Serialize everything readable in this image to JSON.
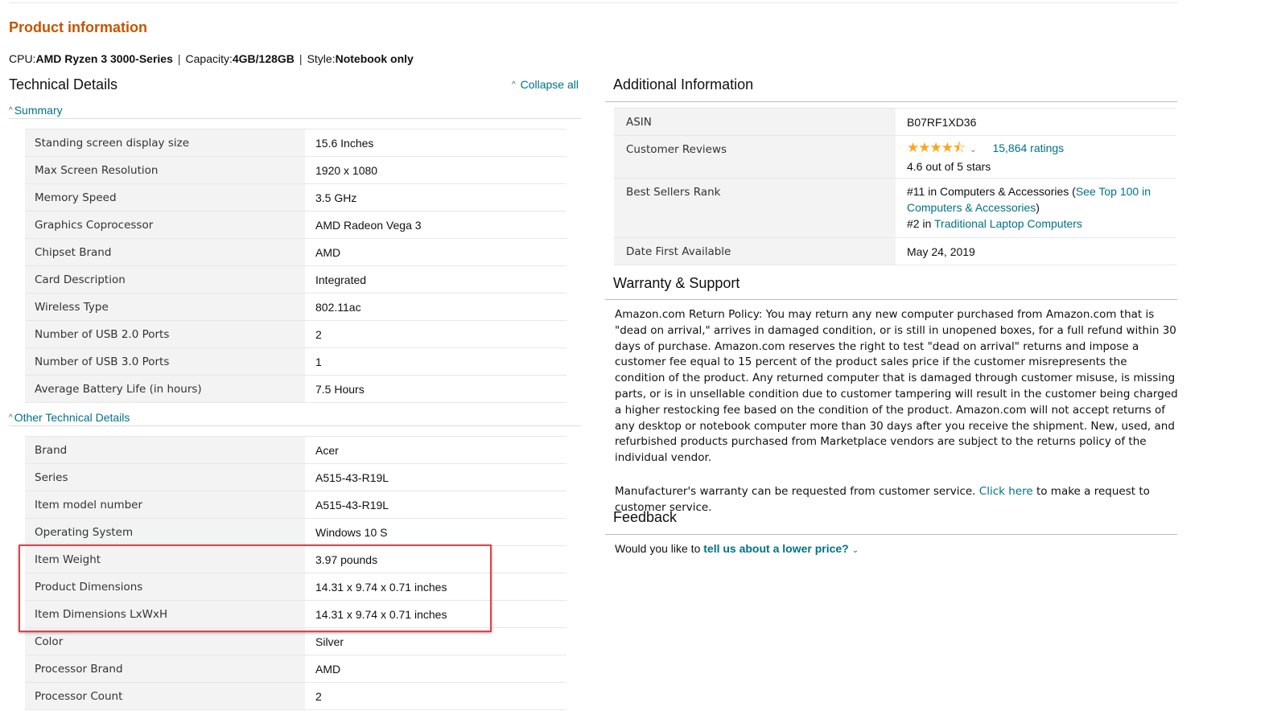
{
  "product_title": "Product information",
  "variant": {
    "cpu_label": "CPU:",
    "cpu_value": "AMD Ryzen 3 3000-Series",
    "capacity_label": "Capacity:",
    "capacity_value": "4GB/128GB",
    "style_label": "Style:",
    "style_value": "Notebook only"
  },
  "technical": {
    "heading": "Technical Details",
    "collapse_all": "Collapse all",
    "summary_label": "Summary",
    "summary_rows": [
      {
        "k": "Standing screen display size",
        "v": "15.6 Inches"
      },
      {
        "k": "Max Screen Resolution",
        "v": "1920 x 1080"
      },
      {
        "k": "Memory Speed",
        "v": "3.5 GHz"
      },
      {
        "k": "Graphics Coprocessor",
        "v": "AMD Radeon Vega 3"
      },
      {
        "k": "Chipset Brand",
        "v": "AMD"
      },
      {
        "k": "Card Description",
        "v": "Integrated"
      },
      {
        "k": "Wireless Type",
        "v": "802.11ac"
      },
      {
        "k": "Number of USB 2.0 Ports",
        "v": "2"
      },
      {
        "k": "Number of USB 3.0 Ports",
        "v": "1"
      },
      {
        "k": "Average Battery Life (in hours)",
        "v": "7.5 Hours"
      }
    ],
    "other_label": "Other Technical Details",
    "other_rows": [
      {
        "k": "Brand",
        "v": "Acer"
      },
      {
        "k": "Series",
        "v": "A515-43-R19L"
      },
      {
        "k": "Item model number",
        "v": "A515-43-R19L"
      },
      {
        "k": "Operating System",
        "v": "Windows 10 S"
      },
      {
        "k": "Item Weight",
        "v": "3.97 pounds"
      },
      {
        "k": "Product Dimensions",
        "v": "14.31 x 9.74 x 0.71 inches"
      },
      {
        "k": "Item Dimensions LxWxH",
        "v": "14.31 x 9.74 x 0.71 inches"
      },
      {
        "k": "Color",
        "v": "Silver"
      },
      {
        "k": "Processor Brand",
        "v": "AMD"
      },
      {
        "k": "Processor Count",
        "v": "2"
      }
    ]
  },
  "additional": {
    "heading": "Additional Information",
    "asin_label": "ASIN",
    "asin_value": "B07RF1XD36",
    "reviews_label": "Customer Reviews",
    "stars": "★★★★⯪",
    "ratings_link": "15,864 ratings",
    "rating_text": "4.6 out of 5 stars",
    "rating_value": 4.6,
    "rank_label": "Best Sellers Rank",
    "rank1_prefix": "#11 in Computers & Accessories (",
    "rank1_link": "See Top 100 in Computers & Accessories",
    "rank1_suffix": ")",
    "rank2_prefix": "#2 in ",
    "rank2_link": "Traditional Laptop Computers",
    "date_label": "Date First Available",
    "date_value": "May 24, 2019"
  },
  "warranty": {
    "heading": "Warranty & Support",
    "policy": "Amazon.com Return Policy: You may return any new computer purchased from Amazon.com that is \"dead on arrival,\" arrives in damaged condition, or is still in unopened boxes, for a full refund within 30 days of purchase. Amazon.com reserves the right to test \"dead on arrival\" returns and impose a customer fee equal to 15 percent of the product sales price if the customer misrepresents the condition of the product. Any returned computer that is damaged through customer misuse, is missing parts, or is in unsellable condition due to customer tampering will result in the customer being charged a higher restocking fee based on the condition of the product. Amazon.com will not accept returns of any desktop or notebook computer more than 30 days after you receive the shipment. New, used, and refurbished products purchased from Marketplace vendors are subject to the returns policy of the individual vendor.",
    "mfr_prefix": "Manufacturer's warranty can be requested from customer service. ",
    "mfr_link": "Click here",
    "mfr_suffix": " to make a request to customer service."
  },
  "feedback": {
    "heading": "Feedback",
    "question": "Would you like to ",
    "link": "tell us about a lower price?"
  },
  "colors": {
    "title": "#C45500",
    "link": "#007185",
    "star": "#FFA41C",
    "highlight_box": "#E0424A",
    "key_bg": "#F3F3F3"
  }
}
